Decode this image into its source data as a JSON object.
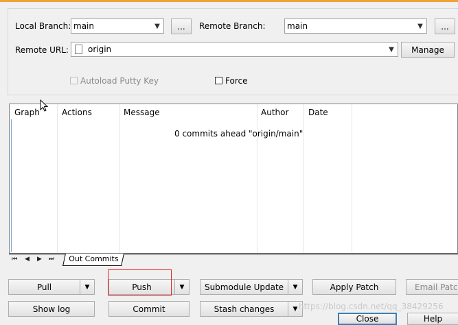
{
  "branch": {
    "local_label": "Local Branch:",
    "local_value": "main",
    "local_browse": "...",
    "remote_label": "Remote Branch:",
    "remote_value": "main",
    "remote_browse": "..."
  },
  "remote": {
    "url_label": "Remote URL:",
    "url_value": "origin",
    "manage_label": "Manage"
  },
  "options": {
    "autoload_label": "Autoload Putty Key",
    "autoload_checked": false,
    "force_label": "Force",
    "force_checked": false
  },
  "grid": {
    "columns": [
      "Graph",
      "Actions",
      "Message",
      "Author",
      "Date"
    ],
    "status_message": "0 commits ahead \"origin/main\""
  },
  "tabs": {
    "nav_first": "⏮",
    "nav_prev": "◀",
    "nav_next": "▶",
    "nav_last": "⏭",
    "active_label": "Out Commits"
  },
  "buttons": {
    "pull": "Pull",
    "push": "Push",
    "submodule_update": "Submodule Update",
    "apply_patch": "Apply Patch",
    "email_patch": "Email Patch",
    "show_log": "Show log",
    "commit": "Commit",
    "stash_changes": "Stash changes",
    "close": "Close",
    "help": "Help"
  },
  "watermark": "https://blog.csdn.net/qq_38429256"
}
